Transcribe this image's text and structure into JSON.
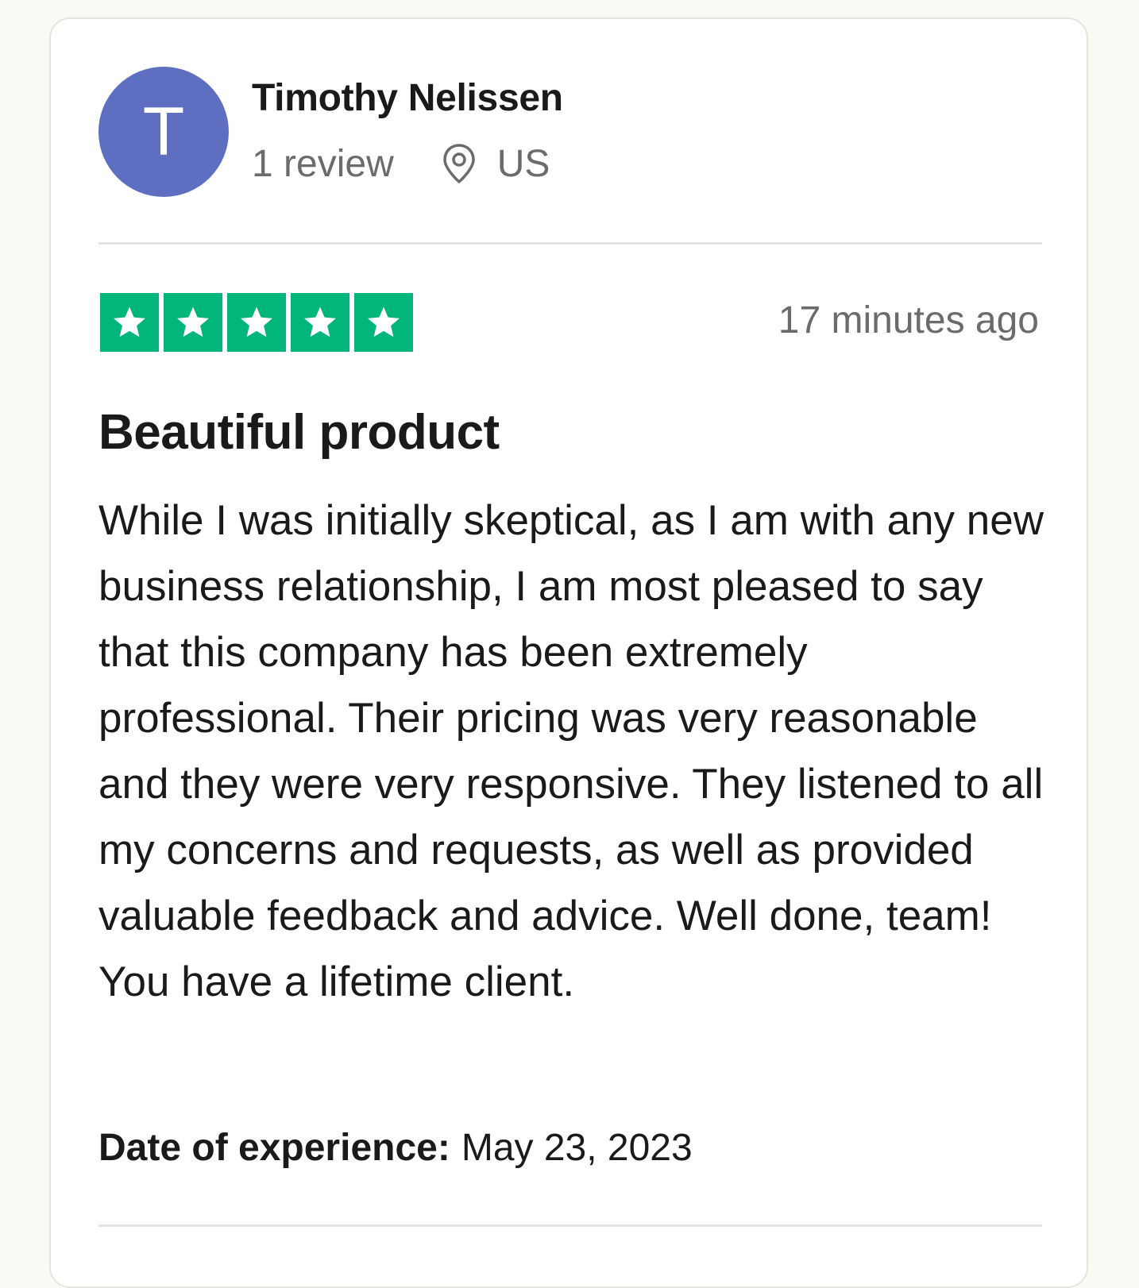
{
  "reviewer": {
    "avatar_initial": "T",
    "avatar_color": "#5e6ec0",
    "name": "Timothy Nelissen",
    "review_count": "1 review",
    "location_icon": "location-pin-icon",
    "location": "US"
  },
  "review": {
    "rating": 5,
    "rating_max": 5,
    "star_color": "#00b67a",
    "star_icon": "star-icon",
    "time_ago": "17 minutes ago",
    "title": "Beautiful product",
    "body": "While I was initially skeptical, as I am with any new business relationship, I am most pleased to say that this company has been extremely professional. Their pricing was very reasonable and they were very responsive. They listened to all my concerns and requests, as well as provided valuable feedback and advice. Well done, team! You have a lifetime client.",
    "date_label": "Date of experience:",
    "date_value": "May 23, 2023"
  }
}
